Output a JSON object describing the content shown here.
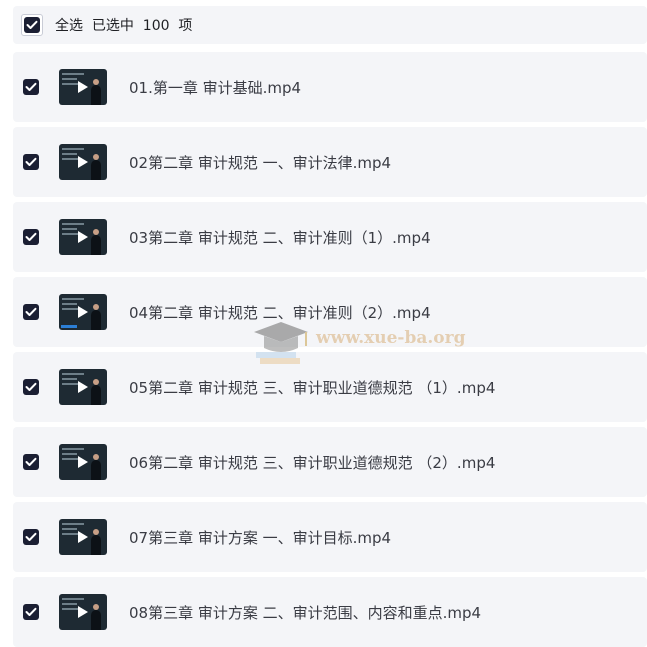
{
  "header": {
    "select_all_label": "全选  已选中  100  项"
  },
  "files": [
    {
      "name": "01.第一章 审计基础.mp4"
    },
    {
      "name": "02第二章 审计规范 一、审计法律.mp4"
    },
    {
      "name": "03第二章 审计规范 二、审计准则（1）.mp4"
    },
    {
      "name": "04第二章 审计规范 二、审计准则（2）.mp4"
    },
    {
      "name": "05第二章 审计规范 三、审计职业道德规范 （1）.mp4"
    },
    {
      "name": "06第二章 审计规范 三、审计职业道德规范 （2）.mp4"
    },
    {
      "name": "07第三章 审计方案 一、审计目标.mp4"
    },
    {
      "name": "08第三章 审计方案 二、审计范围、内容和重点.mp4"
    }
  ],
  "watermark": {
    "text": "www.xue-ba.org"
  },
  "colors": {
    "checkbox": "#1b1f33",
    "row_bg": "#f4f5f8",
    "watermark": "#d8b07a"
  }
}
